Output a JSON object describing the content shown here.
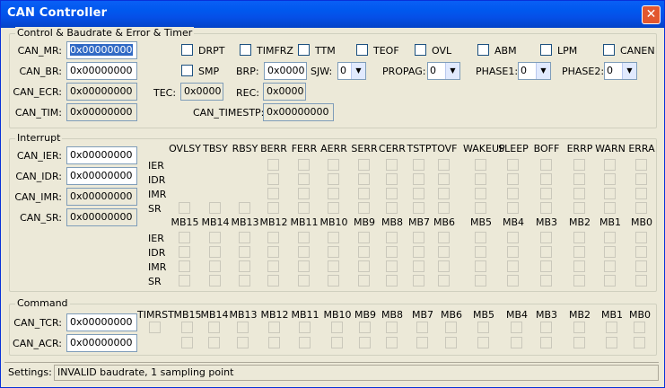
{
  "window": {
    "title": "CAN Controller",
    "close_label": "✕"
  },
  "control": {
    "legend": "Control & Baudrate & Error & Timer",
    "regs": [
      {
        "label": "CAN_MR:",
        "value": "0x00000000",
        "selected": true
      },
      {
        "label": "CAN_BR:",
        "value": "0x00000000"
      },
      {
        "label": "CAN_ECR:",
        "value": "0x00000000",
        "readonly": true
      },
      {
        "label": "CAN_TIM:",
        "value": "0x00000000",
        "readonly": true
      }
    ],
    "flags": [
      "DRPT",
      "TIMFRZ",
      "TTM",
      "TEOF",
      "OVL",
      "ABM",
      "LPM",
      "CANEN"
    ],
    "smp": "SMP",
    "brp": {
      "label": "BRP:",
      "value": "0x0000"
    },
    "sjw": {
      "label": "SJW:",
      "value": "0"
    },
    "propag": {
      "label": "PROPAG:",
      "value": "0"
    },
    "phase1": {
      "label": "PHASE1:",
      "value": "0"
    },
    "phase2": {
      "label": "PHASE2:",
      "value": "0"
    },
    "tec": {
      "label": "TEC:",
      "value": "0x0000"
    },
    "rec": {
      "label": "REC:",
      "value": "0x0000"
    },
    "timestp": {
      "label": "CAN_TIMESTP:",
      "value": "0x00000000"
    }
  },
  "interrupt": {
    "legend": "Interrupt",
    "regs": [
      {
        "label": "CAN_IER:",
        "value": "0x00000000"
      },
      {
        "label": "CAN_IDR:",
        "value": "0x00000000"
      },
      {
        "label": "CAN_IMR:",
        "value": "0x00000000",
        "readonly": true
      },
      {
        "label": "CAN_SR:",
        "value": "0x00000000",
        "readonly": true
      }
    ],
    "row_labels": [
      "IER",
      "IDR",
      "IMR",
      "SR"
    ],
    "status_cols": [
      "OVLSY",
      "TBSY",
      "RBSY",
      "BERR",
      "FERR",
      "AERR",
      "SERR",
      "CERR",
      "TSTP",
      "TOVF",
      "WAKEUP",
      "SLEEP",
      "BOFF",
      "ERRP",
      "WARN",
      "ERRA"
    ],
    "mb_cols": [
      "MB15",
      "MB14",
      "MB13",
      "MB12",
      "MB11",
      "MB10",
      "MB9",
      "MB8",
      "MB7",
      "MB6",
      "MB5",
      "MB4",
      "MB3",
      "MB2",
      "MB1",
      "MB0"
    ]
  },
  "command": {
    "legend": "Command",
    "regs": [
      {
        "label": "CAN_TCR:",
        "value": "0x00000000"
      },
      {
        "label": "CAN_ACR:",
        "value": "0x00000000"
      }
    ],
    "cols": [
      "TIMRST",
      "MB15",
      "MB14",
      "MB13",
      "MB12",
      "MB11",
      "MB10",
      "MB9",
      "MB8",
      "MB7",
      "MB6",
      "MB5",
      "MB4",
      "MB3",
      "MB2",
      "MB1",
      "MB0"
    ]
  },
  "status": {
    "label": "Settings:",
    "text": "INVALID baudrate, 1 sampling point"
  }
}
